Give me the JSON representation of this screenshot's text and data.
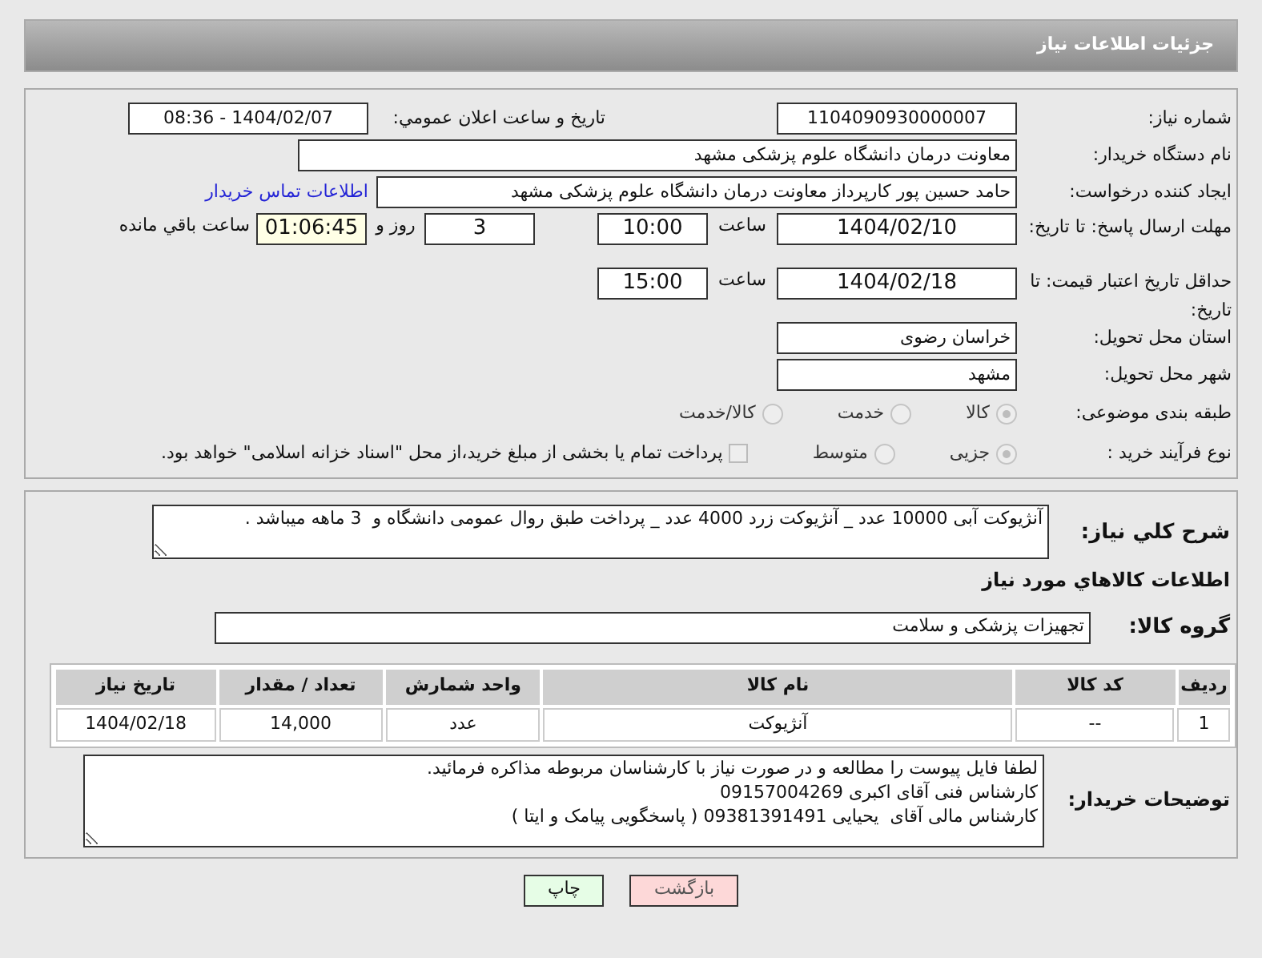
{
  "header": {
    "title": "جزئیات اطلاعات نیاز"
  },
  "details": {
    "need_number": {
      "label": "شماره نیاز:",
      "value": "1104090930000007"
    },
    "announce": {
      "label": "تاریخ و ساعت اعلان عمومي:",
      "value": "1404/02/07 - 08:36"
    },
    "buyer": {
      "label": "نام دستگاه خریدار:",
      "value": "معاونت درمان دانشگاه علوم پزشکی مشهد"
    },
    "creator": {
      "label": "ایجاد کننده درخواست:",
      "value": "حامد حسین پور کارپرداز معاونت درمان دانشگاه علوم پزشکی مشهد",
      "link": "اطلاعات تماس خریدار"
    },
    "deadline": {
      "label": "مهلت ارسال پاسخ: تا تاریخ:",
      "date": "1404/02/10",
      "time_label": "ساعت",
      "time": "10:00",
      "days": "3",
      "days_label": "روز و",
      "remaining": "01:06:45",
      "remaining_label": "ساعت باقي مانده"
    },
    "validity": {
      "label": "حداقل تاریخ اعتبار قیمت: تا تاریخ:",
      "date": "1404/02/18",
      "time_label": "ساعت",
      "time": "15:00"
    },
    "province": {
      "label": "استان محل تحویل:",
      "value": "خراسان رضوی"
    },
    "city": {
      "label": "شهر محل تحویل:",
      "value": "مشهد"
    },
    "category": {
      "label": "طبقه بندی موضوعی:",
      "options": [
        {
          "label": "کالا",
          "selected": true
        },
        {
          "label": "خدمت",
          "selected": false
        },
        {
          "label": "کالا/خدمت",
          "selected": false
        }
      ]
    },
    "process": {
      "label": "نوع فرآیند خرید :",
      "options": [
        {
          "label": "جزیی",
          "selected": true
        },
        {
          "label": "متوسط",
          "selected": false
        }
      ],
      "payment": {
        "label": "پرداخت تمام یا بخشی از مبلغ خرید،از محل \"اسناد خزانه اسلامی\" خواهد بود.",
        "checked": false
      }
    }
  },
  "summary": {
    "label": "شرح کلي نیاز:",
    "value": "آنژیوکت آبی 10000 عدد _ آنژیوکت زرد 4000 عدد _ پرداخت طبق روال عمومی دانشگاه و  3 ماهه میباشد ."
  },
  "goods": {
    "title": "اطلاعات کالاهاي مورد نیاز",
    "group_label": "گروه کالا:",
    "group": "تجهیزات پزشکی و سلامت",
    "table": {
      "columns": [
        "ردیف",
        "کد کالا",
        "نام کالا",
        "واحد شمارش",
        "تعداد / مقدار",
        "تاریخ نیاز"
      ],
      "rows": [
        [
          "1",
          "--",
          "آنژیوکت",
          "عدد",
          "14,000",
          "1404/02/18"
        ]
      ]
    }
  },
  "notes": {
    "label": "توضیحات خریدار:",
    "lines": [
      "لطفا فایل پیوست را مطالعه و در صورت نیاز با کارشناسان مربوطه مذاکره فرمائید.",
      "کارشناس فنی آقای اکبری 09157004269",
      "کارشناس مالی آقای  یحیایی 09381391491 ( پاسخگویی پیامک و ایتا )"
    ]
  },
  "buttons": [
    {
      "label": "بازگشت",
      "kind": "back"
    },
    {
      "label": "چاپ",
      "kind": "print"
    }
  ]
}
